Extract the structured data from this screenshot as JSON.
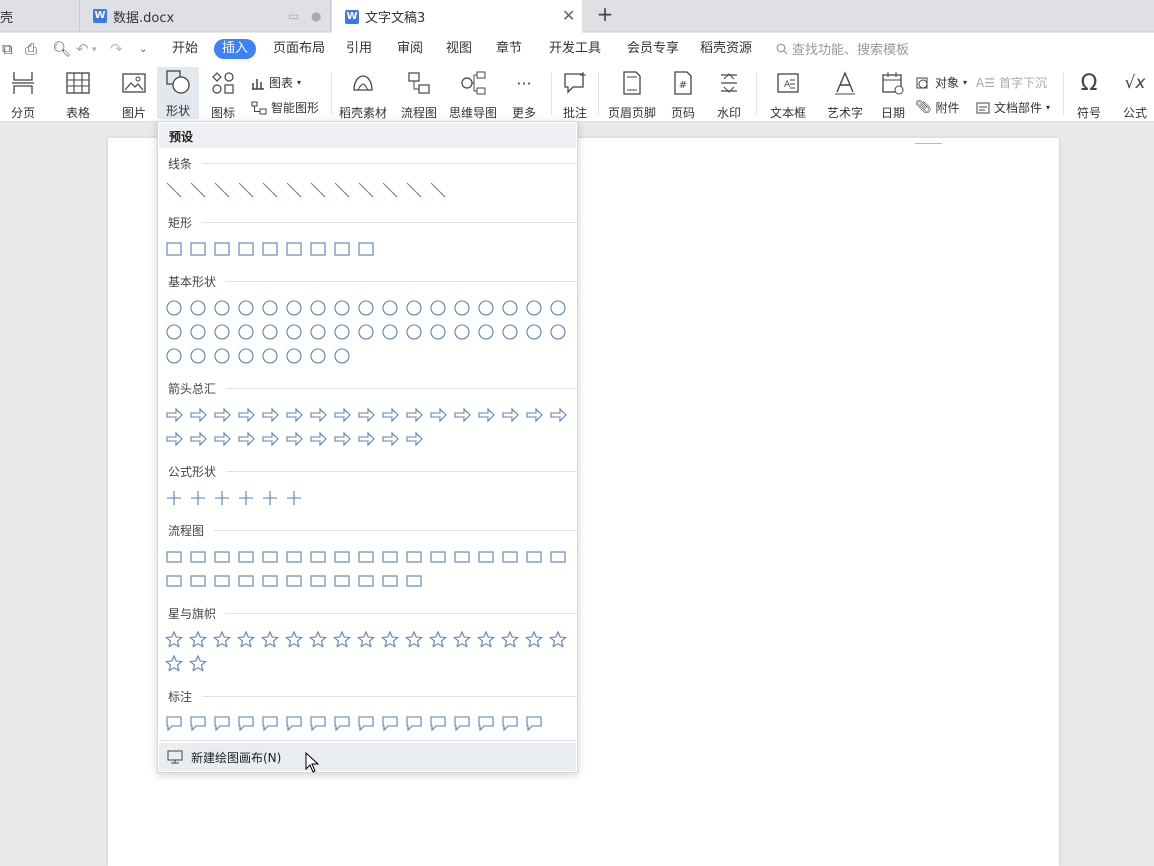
{
  "tabs": [
    {
      "label": "壳"
    },
    {
      "label": "数据.docx"
    },
    {
      "label": "文字文稿3"
    }
  ],
  "newtab_label": "+",
  "menu": {
    "tabs": [
      "开始",
      "插入",
      "页面布局",
      "引用",
      "审阅",
      "视图",
      "章节",
      "开发工具",
      "会员专享",
      "稻壳资源"
    ],
    "search_placeholder": "查找功能、搜索模板"
  },
  "ribbon": {
    "page_break": "分页",
    "table": "表格",
    "picture": "图片",
    "shape": "形状",
    "icon": "图标",
    "chart": "图表",
    "smart_graphic": "智能图形",
    "docer_material": "稻壳素材",
    "flowchart": "流程图",
    "mindmap": "思维导图",
    "more": "更多",
    "comment": "批注",
    "header_footer": "页眉页脚",
    "page_number": "页码",
    "watermark": "水印",
    "textbox": "文本框",
    "wordart": "艺术字",
    "date": "日期",
    "object": "对象",
    "drop_cap": "首字下沉",
    "attachment": "附件",
    "doc_parts": "文档部件",
    "symbol": "符号",
    "formula": "公式"
  },
  "shapes_panel": {
    "title": "预设",
    "categories": [
      {
        "label": "线条",
        "count": 12
      },
      {
        "label": "矩形",
        "count": 9
      },
      {
        "label": "基本形状",
        "count": 42
      },
      {
        "label": "箭头总汇",
        "count": 28
      },
      {
        "label": "公式形状",
        "count": 6
      },
      {
        "label": "流程图",
        "count": 28
      },
      {
        "label": "星与旗帜",
        "count": 19
      },
      {
        "label": "标注",
        "count": 16
      }
    ],
    "new_canvas": "新建绘图画布(N)"
  },
  "colors": {
    "accent": "#3b82f6",
    "shape_stroke": "#5b7fbd",
    "icon_blue": "#3b7ae6"
  }
}
